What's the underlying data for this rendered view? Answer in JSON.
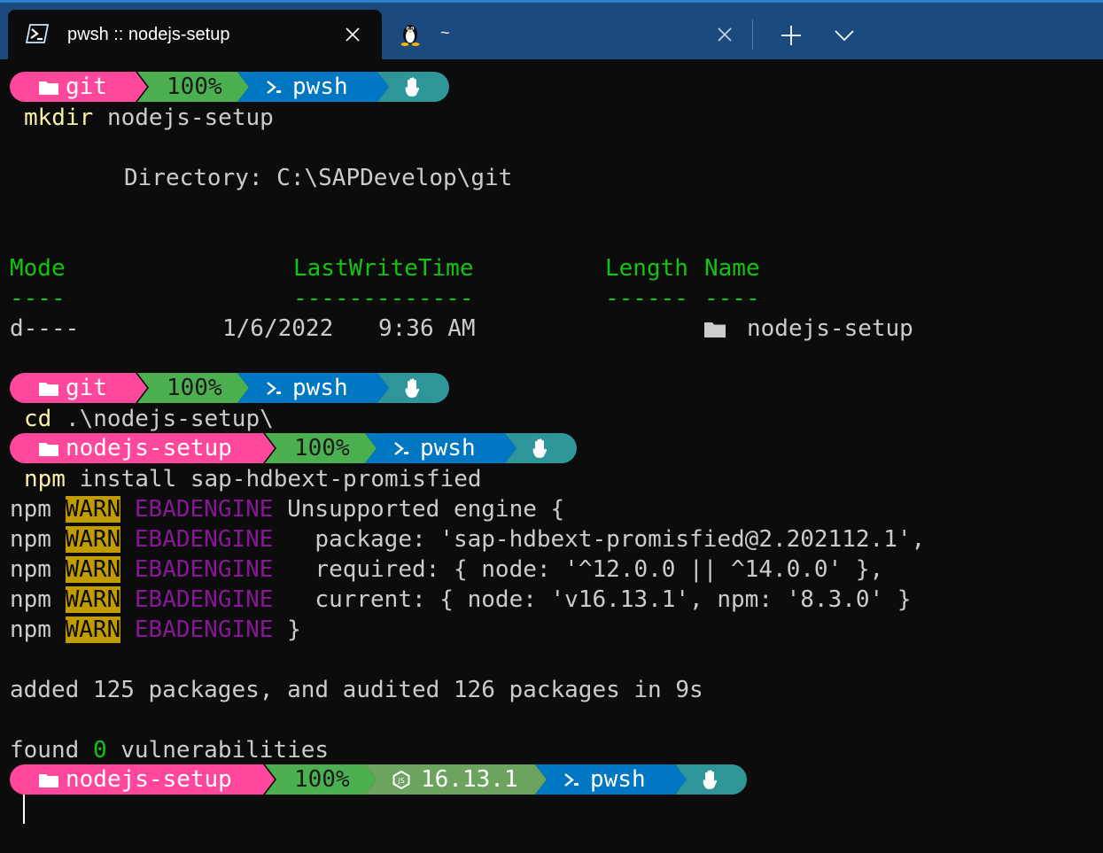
{
  "window": {
    "active_tab": {
      "title": "pwsh :: nodejs-setup",
      "icon": "powershell-icon"
    },
    "inactive_tab": {
      "title": "~",
      "icon": "linux-tux-icon"
    },
    "buttons": {
      "new_tab": "plus-icon",
      "dropdown": "chevron-down-icon",
      "close": "close-icon"
    }
  },
  "colors": {
    "titlebar": "#1b4a7e",
    "terminal_bg": "#0c0c0c",
    "segment_folder": "#ff479c",
    "segment_battery": "#4caf50",
    "segment_node": "#6ca35e",
    "segment_shell": "#0077c2",
    "segment_root": "#2e9599",
    "warn_bg": "#c19c00",
    "engine_purple": "#881798",
    "header_green": "#13c410"
  },
  "prompts": [
    {
      "folder": "git",
      "battery": "100%",
      "shell": "pwsh",
      "root_icon": "hand-icon"
    },
    {
      "folder": "git",
      "battery": "100%",
      "shell": "pwsh",
      "root_icon": "hand-icon"
    },
    {
      "folder": "nodejs-setup",
      "battery": "100%",
      "shell": "pwsh",
      "root_icon": "hand-icon"
    },
    {
      "folder": "nodejs-setup",
      "battery": "100%",
      "node_version": "16.13.1",
      "shell": "pwsh",
      "root_icon": "hand-icon"
    }
  ],
  "commands": {
    "mkdir": {
      "cmd": "mkdir",
      "args": "nodejs-setup"
    },
    "cd": {
      "cmd": "cd",
      "args": ".\\nodejs-setup\\"
    },
    "npm": {
      "cmd": "npm",
      "args": "install sap-hdbext-promisfied"
    }
  },
  "dir_output": {
    "directory_line": "Directory: C:\\SAPDevelop\\git",
    "headers": {
      "mode": "Mode",
      "lastwrite": "LastWriteTime",
      "length": "Length",
      "name": "Name"
    },
    "underlines": {
      "mode": "----",
      "lastwrite": "-------------",
      "length": "------",
      "name": "----"
    },
    "row": {
      "mode": "d----",
      "date": "1/6/2022",
      "time": "9:36 AM",
      "name": "nodejs-setup",
      "icon": "folder-icon"
    }
  },
  "npm_warnings": [
    {
      "prefix": "npm",
      "level": "WARN",
      "code": "EBADENGINE",
      "message": "Unsupported engine {"
    },
    {
      "prefix": "npm",
      "level": "WARN",
      "code": "EBADENGINE",
      "message": "  package: 'sap-hdbext-promisfied@2.202112.1',"
    },
    {
      "prefix": "npm",
      "level": "WARN",
      "code": "EBADENGINE",
      "message": "  required: { node: '^12.0.0 || ^14.0.0' },"
    },
    {
      "prefix": "npm",
      "level": "WARN",
      "code": "EBADENGINE",
      "message": "  current: { node: 'v16.13.1', npm: '8.3.0' }"
    },
    {
      "prefix": "npm",
      "level": "WARN",
      "code": "EBADENGINE",
      "message": "}"
    }
  ],
  "summary": {
    "added": "added 125 packages, and audited 126 packages in 9s",
    "found_prefix": "found",
    "found_count": "0",
    "found_suffix": "vulnerabilities"
  }
}
